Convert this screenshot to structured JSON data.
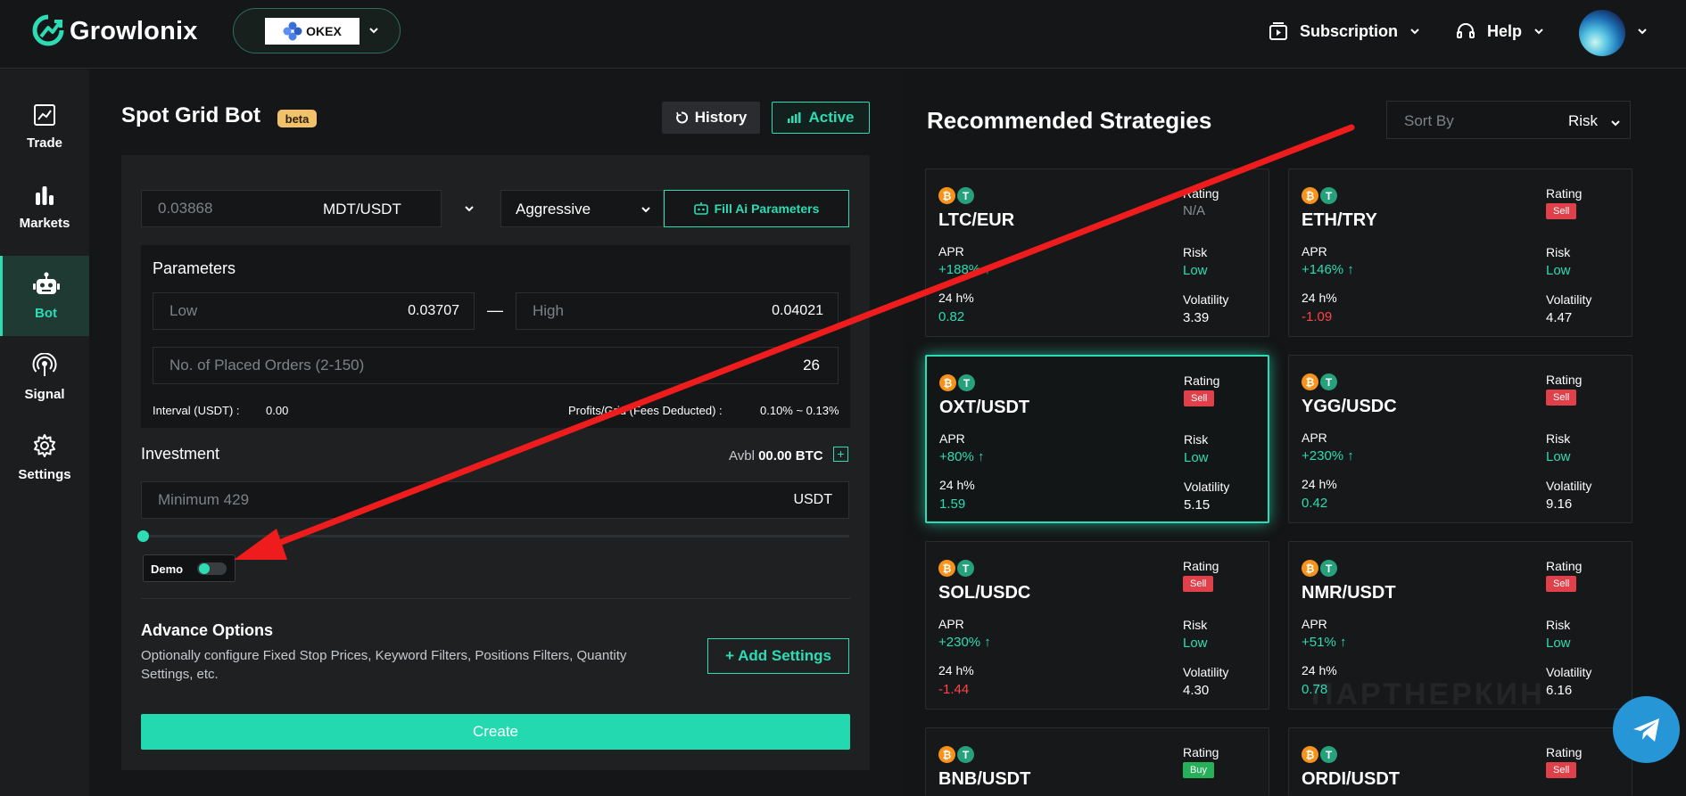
{
  "header": {
    "brand": "Growlonix",
    "exchange": "OKEX",
    "subscription": "Subscription",
    "help": "Help"
  },
  "sidebar": {
    "items": [
      {
        "label": "Trade",
        "icon": "trade-chart-icon"
      },
      {
        "label": "Markets",
        "icon": "bar-chart-icon"
      },
      {
        "label": "Bot",
        "icon": "robot-icon",
        "active": true
      },
      {
        "label": "Signal",
        "icon": "signal-broadcast-icon"
      },
      {
        "label": "Settings",
        "icon": "gear-icon"
      }
    ]
  },
  "bot": {
    "title": "Spot Grid Bot",
    "badge": "beta",
    "history_label": "History",
    "active_label": "Active",
    "price_value": "0.03868",
    "pair": "MDT/USDT",
    "strategy": "Aggressive",
    "fill_ai_label": "Fill Ai Parameters",
    "parameters_title": "Parameters",
    "low_label": "Low",
    "low_value": "0.03707",
    "range_sep": "—",
    "high_label": "High",
    "high_value": "0.04021",
    "orders_label": "No. of Placed Orders (2-150)",
    "orders_value": "26",
    "interval_label": "Interval (USDT) :",
    "interval_value": "0.00",
    "profit_label": "Profits/Grid (Fees Deducted) :",
    "profit_value": "0.10% ~ 0.13%",
    "investment_title": "Investment",
    "avbl_label": "Avbl",
    "avbl_value": "00.00 BTC",
    "investment_placeholder": "Minimum 429",
    "investment_unit": "USDT",
    "demo_label": "Demo",
    "demo_enabled": true,
    "advance_title": "Advance Options",
    "advance_desc": "Optionally configure Fixed Stop Prices, Keyword Filters, Positions Filters, Quantity Settings, etc.",
    "add_settings_label": "+ Add Settings",
    "create_label": "Create"
  },
  "recommended": {
    "title": "Recommended Strategies",
    "sort_placeholder": "Sort By",
    "sort_value": "Risk",
    "labels": {
      "rating": "Rating",
      "apr": "APR",
      "h24": "24 h%",
      "risk": "Risk",
      "volatility": "Volatility"
    },
    "strategies": [
      {
        "pair": "LTC/EUR",
        "rating": "N/A",
        "apr": "+188%",
        "h24": "0.82",
        "risk": "Low",
        "volatility": "3.39"
      },
      {
        "pair": "ETH/TRY",
        "rating": "Sell",
        "apr": "+146%",
        "h24": "-1.09",
        "risk": "Low",
        "volatility": "4.47"
      },
      {
        "pair": "OXT/USDT",
        "rating": "Sell",
        "apr": "+80%",
        "h24": "1.59",
        "risk": "Low",
        "volatility": "5.15"
      },
      {
        "pair": "YGG/USDC",
        "rating": "Sell",
        "apr": "+230%",
        "h24": "0.42",
        "risk": "Low",
        "volatility": "9.16"
      },
      {
        "pair": "SOL/USDC",
        "rating": "Sell",
        "apr": "+230%",
        "h24": "-1.44",
        "risk": "Low",
        "volatility": "4.30"
      },
      {
        "pair": "NMR/USDT",
        "rating": "Sell",
        "apr": "+51%",
        "h24": "0.78",
        "risk": "Low",
        "volatility": "6.16"
      },
      {
        "pair": "BNB/USDT",
        "rating": "Buy"
      },
      {
        "pair": "ORDI/USDT",
        "rating": "Sell"
      }
    ]
  },
  "watermark": "ПАРТНЕРКИН",
  "colors": {
    "accent": "#2cdcb4",
    "sell": "#e0404a",
    "buy": "#27b05a",
    "negative": "#ff4444",
    "beta": "#f2c26a"
  }
}
